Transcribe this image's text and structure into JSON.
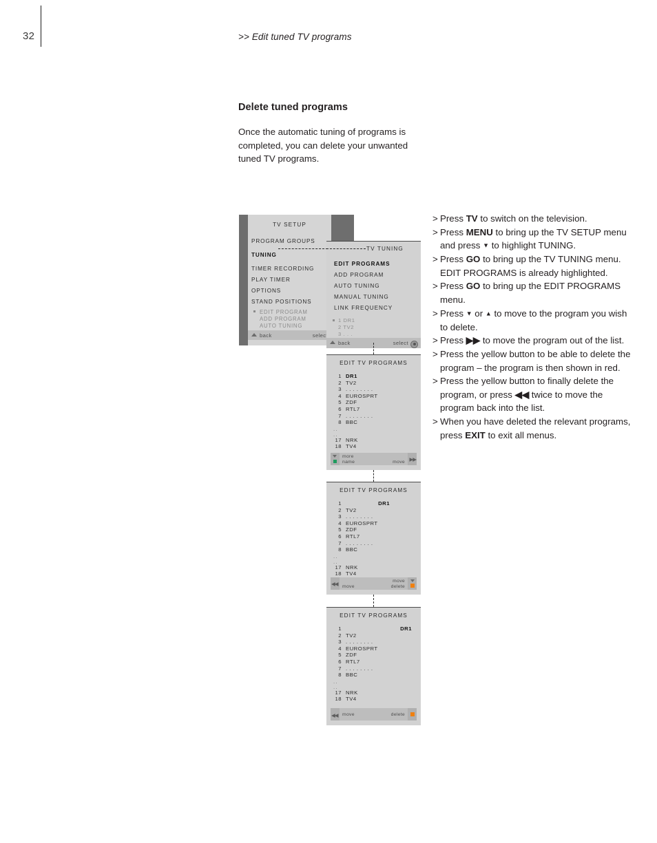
{
  "page": {
    "number": "32",
    "running_head": ">> Edit tuned TV programs"
  },
  "content": {
    "section_title": "Delete tuned programs",
    "intro": "Once the automatic tuning of programs is completed, you can delete your unwanted tuned TV programs."
  },
  "steps": [
    {
      "marker": ">",
      "html": "Press <b>TV</b> to switch on the television."
    },
    {
      "marker": ">",
      "html": "Press <b>MENU</b> to bring up the TV SETUP menu and press <span class=\"arw\">▼</span> to highlight TUNING."
    },
    {
      "marker": ">",
      "html": "Press <b>GO</b> to bring up the TV TUNING menu. EDIT PROGRAMS is already highlighted."
    },
    {
      "marker": ">",
      "html": "Press <b>GO</b> to bring up the EDIT PROGRAMS menu."
    },
    {
      "marker": ">",
      "html": "Press <span class=\"arw\">▼</span> or <span class=\"arw\">▲</span> to move to the program you wish to delete."
    },
    {
      "marker": ">",
      "html": "Press <b>▶▶</b> to move the program out of the list."
    },
    {
      "marker": ">",
      "html": "Press the yellow button to be able to delete the program – the program is then shown in red."
    },
    {
      "marker": ">",
      "html": "Press the yellow button to finally delete the program, or press <b>◀◀</b> twice to move the program back into the list."
    },
    {
      "marker": ">",
      "html": "When you have deleted the relevant programs, press <b>EXIT</b> to exit all menus."
    }
  ],
  "osd": {
    "tv_setup": {
      "title": "TV  SETUP",
      "items": [
        {
          "label": "PROGRAM  GROUPS",
          "highlighted": false
        },
        {
          "label": "TUNING",
          "highlighted": true
        },
        {
          "label": "TIMER  RECORDING",
          "highlighted": false
        },
        {
          "label": "PLAY  TIMER",
          "highlighted": false
        },
        {
          "label": "OPTIONS",
          "highlighted": false
        },
        {
          "label": "STAND  POSITIONS",
          "highlighted": false
        }
      ],
      "sub_items": [
        "EDIT  PROGRAM",
        "ADD  PROGRAM",
        "AUTO  TUNING"
      ],
      "bottom": {
        "left": "back",
        "right": "select"
      }
    },
    "tv_tuning": {
      "title": "TV  TUNING",
      "items": [
        {
          "label": "EDIT  PROGRAMS",
          "highlighted": true
        },
        {
          "label": "ADD  PROGRAM",
          "highlighted": false
        },
        {
          "label": "AUTO  TUNING",
          "highlighted": false
        },
        {
          "label": "MANUAL  TUNING",
          "highlighted": false
        },
        {
          "label": "LINK  FREQUENCY",
          "highlighted": false
        }
      ],
      "sub_items": [
        "1 DR1",
        "2 TV2",
        "3 . . ."
      ],
      "bottom": {
        "left": "back",
        "right": "select",
        "icon": "go-wheel-icon"
      }
    },
    "edit_programs_title": "EDIT  TV  PROGRAMS",
    "program_list": [
      {
        "num": "1",
        "name": "DR1"
      },
      {
        "num": "2",
        "name": "TV2"
      },
      {
        "num": "3",
        "name": ". . . . . . . ."
      },
      {
        "num": "4",
        "name": "EUROSPRT"
      },
      {
        "num": "5",
        "name": "ZDF"
      },
      {
        "num": "6",
        "name": "RTL7"
      },
      {
        "num": "7",
        "name": ". . . . . . . ."
      },
      {
        "num": "8",
        "name": "BBC"
      },
      {
        "num": "..",
        "name": ""
      },
      {
        "num": "..",
        "name": ""
      },
      {
        "num": "17",
        "name": "NRK"
      },
      {
        "num": "18",
        "name": "TV4"
      }
    ],
    "stage2_bottom": {
      "line1_left": "more",
      "line2_left": "name",
      "right": "move",
      "green_square": "#1f9b5e"
    },
    "stage3_bottom": {
      "left": "move",
      "right_line1": "move",
      "right_line2": "delete",
      "orange_square": "#f08010"
    },
    "stage4_bottom": {
      "left": "move",
      "right": "delete",
      "orange_square": "#f08010"
    }
  },
  "colors": {
    "osd_background": "#d2d2d2",
    "osd_bar": "#bdbdbd",
    "osd_dark_edge": "#6e6e6e",
    "text": "#231f20"
  }
}
